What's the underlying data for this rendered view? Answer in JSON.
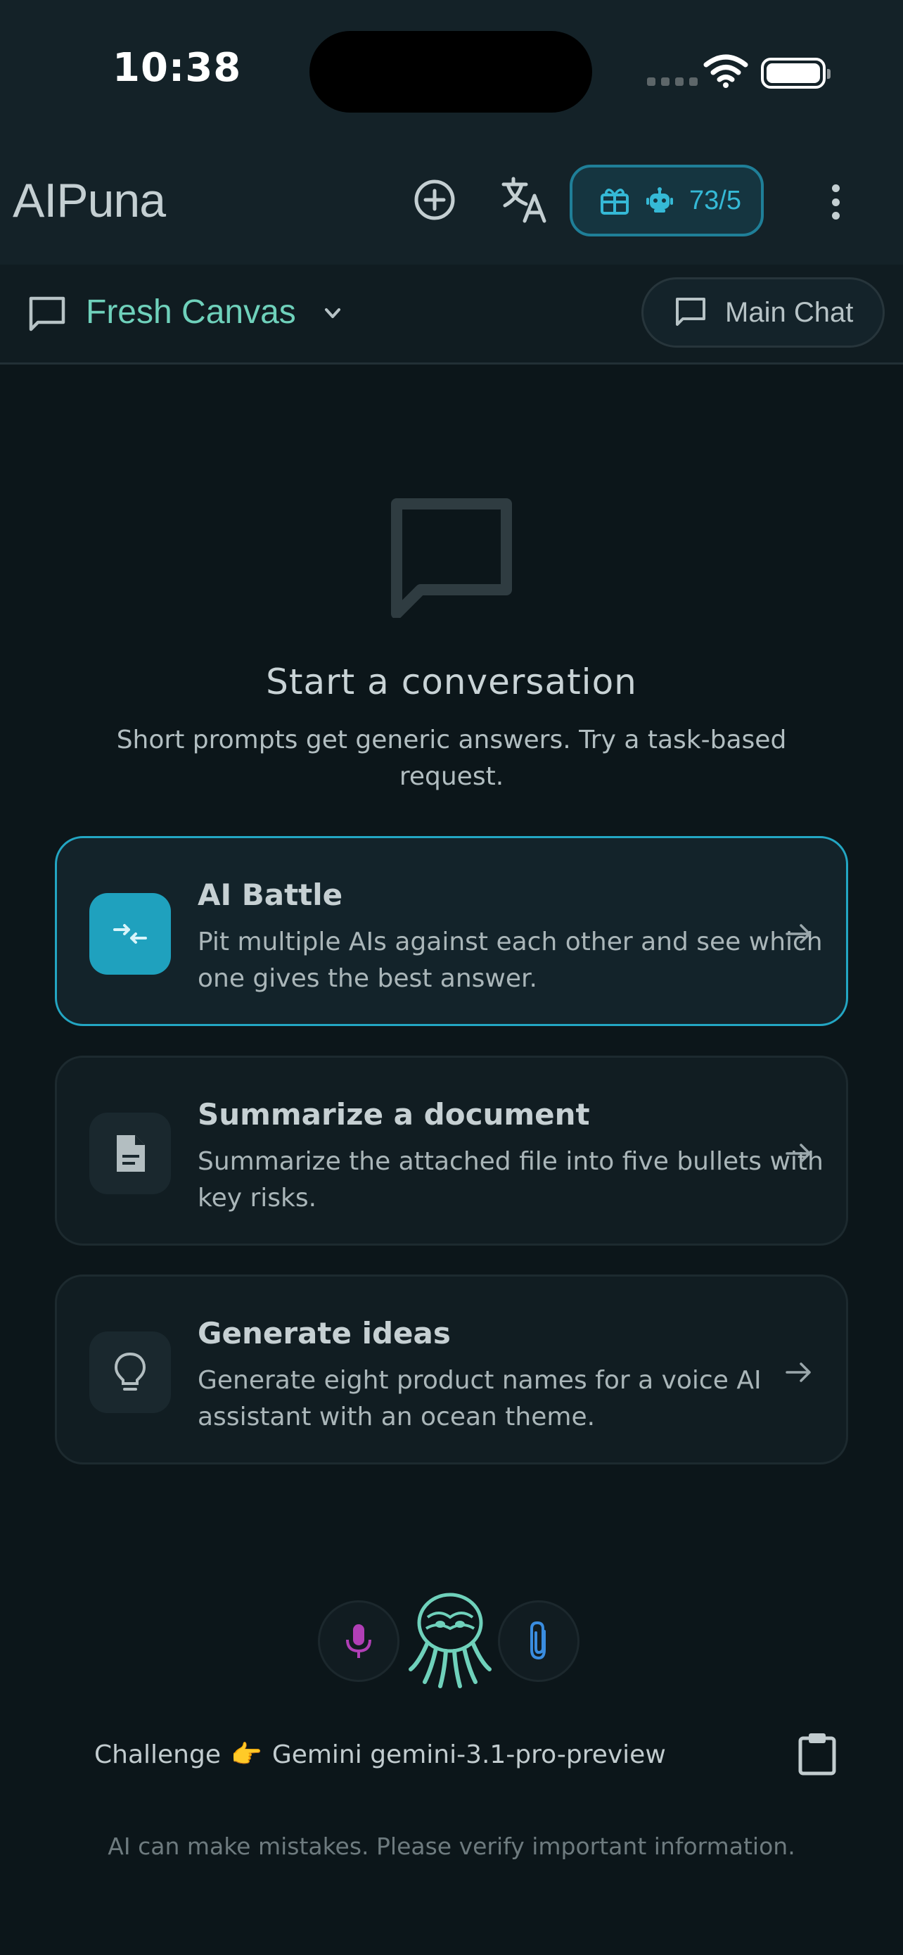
{
  "status_bar": {
    "time": "10:38"
  },
  "header": {
    "app_title": "AIPuna",
    "icons": [
      "plus-circle-icon",
      "translate-icon",
      "more-vertical-icon"
    ],
    "credits": {
      "count": "73/5",
      "icons": [
        "gift-icon",
        "robot-icon"
      ]
    }
  },
  "thread_bar": {
    "current_thread": "Fresh Canvas",
    "main_chat_label": "Main Chat"
  },
  "empty_state": {
    "title": "Start a conversation",
    "subtitle": "Short prompts get generic answers. Try a task-based request."
  },
  "suggestions": [
    {
      "title": "AI Battle",
      "description": "Pit multiple AIs against each other and see which one gives the best answer.",
      "icon": "swap-arrows-icon",
      "highlighted": true
    },
    {
      "title": "Summarize a document",
      "description": "Summarize the attached file into five bullets with key risks.",
      "icon": "document-icon",
      "highlighted": false
    },
    {
      "title": "Generate ideas",
      "description": "Generate eight product names for a voice AI assistant with an ocean theme.",
      "icon": "lightbulb-icon",
      "highlighted": false
    }
  ],
  "input_controls": {
    "mic_icon": "microphone-icon",
    "attach_icon": "paperclip-icon",
    "mascot": "octopus-mascot"
  },
  "challenge": {
    "prefix": "Challenge",
    "emoji": "👉",
    "model": "Gemini gemini-3.1-pro-preview"
  },
  "disclaimer": "AI can make mistakes. Please verify important information.",
  "colors": {
    "accent_teal": "#6fd1bb",
    "accent_cyan": "#23a6c3",
    "mic_purple": "#b13fb6",
    "clip_blue": "#3a8de0",
    "background": "#0c161a"
  }
}
